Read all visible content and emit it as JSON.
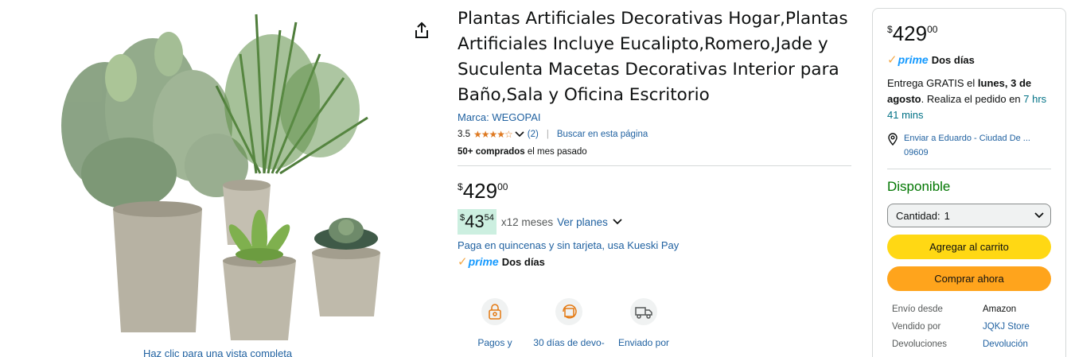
{
  "gallery": {
    "caption": "Haz clic para una vista completa",
    "share_icon": "share-icon"
  },
  "product": {
    "title": "Plantas Artificiales Decorativas Hogar,Plantas Artificiales Incluye Eucalipto,Romero,Jade y Suculenta Macetas Decorativas Interior para Baño,Sala y Oficina Escritorio",
    "brand": "Marca: WEGOPAI",
    "rating": "3.5",
    "stars": "★★★★☆",
    "reviews": "(2)",
    "search_link": "Buscar en esta página",
    "bought_bold": "50+ comprados",
    "bought_rest": " el mes pasado",
    "price": {
      "currency": "$",
      "whole": "429",
      "fraction": "00"
    },
    "installment": {
      "currency": "$",
      "whole": "43",
      "fraction": "54",
      "times": "x12 meses",
      "link": "Ver planes"
    },
    "kueski": "Paga en quincenas y sin tarjeta, usa Kueski Pay",
    "prime": {
      "check": "✓",
      "word": "prime",
      "days": "Dos días"
    },
    "features": [
      {
        "label": "Pagos y",
        "icon": "secure-payment-icon"
      },
      {
        "label": "30 días de devo-",
        "icon": "returns-box-icon"
      },
      {
        "label": "Enviado por",
        "icon": "delivery-truck-icon"
      }
    ]
  },
  "buybox": {
    "price": {
      "currency": "$",
      "whole": "429",
      "fraction": "00"
    },
    "prime": {
      "check": "✓",
      "word": "prime",
      "days": "Dos días"
    },
    "delivery_pre": "Entrega GRATIS el ",
    "delivery_date": "lunes, 3 de agosto",
    "delivery_mid": ". Realiza el pedido en ",
    "delivery_time": "7 hrs 41 mins",
    "location_line1": "Enviar a Eduardo - Ciudad De ...",
    "location_line2": "09609",
    "stock": "Disponible",
    "qty_label": "Cantidad:",
    "qty_value": "1",
    "add_to_cart": "Agregar al carrito",
    "buy_now": "Comprar ahora",
    "info": [
      {
        "key": "Envío desde",
        "value": "Amazon"
      },
      {
        "key": "Vendido por",
        "value": "JQKJ Store"
      },
      {
        "key": "Devoluciones",
        "value": "Devolución"
      }
    ],
    "colors": {
      "add_to_cart": "#ffd814",
      "buy_now": "#ffa41c",
      "stock": "#007600"
    }
  }
}
